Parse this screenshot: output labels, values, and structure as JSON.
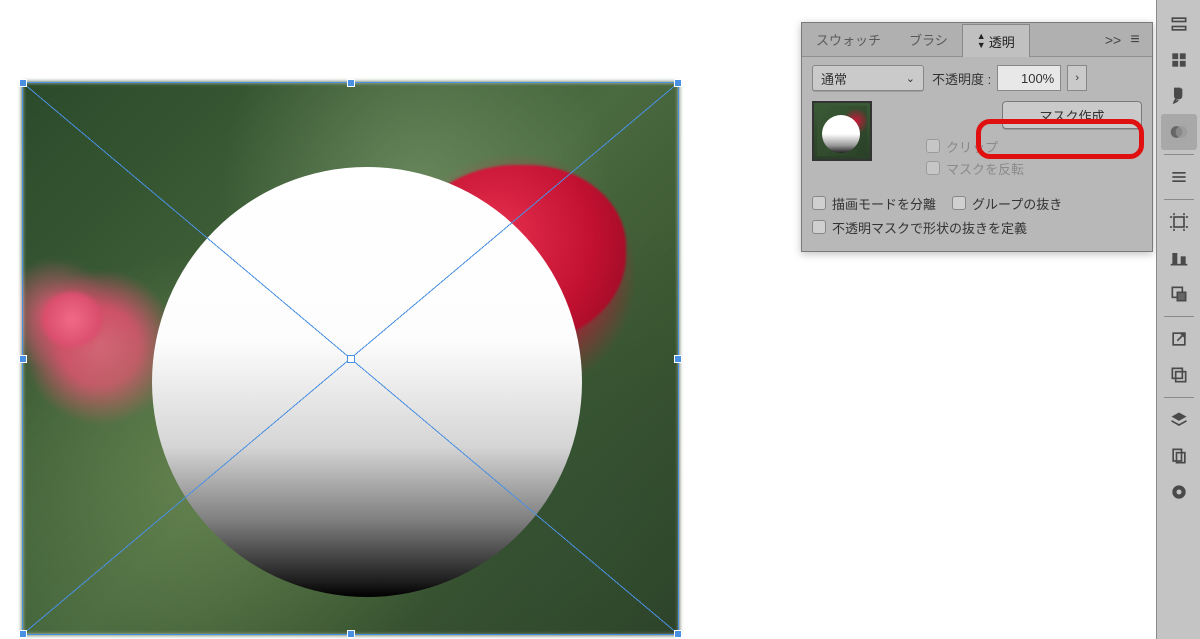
{
  "panel": {
    "tabs": {
      "swatches": "スウォッチ",
      "brushes": "ブラシ",
      "transparency": "透明"
    },
    "collapse": ">>",
    "blend_mode": "通常",
    "opacity_label": "不透明度 :",
    "opacity_value": "100%",
    "make_mask": "マスク作成",
    "clip": "クリップ",
    "invert_mask": "マスクを反転",
    "isolate_blending": "描画モードを分離",
    "knockout_group": "グループの抜き",
    "opacity_mask_define": "不透明マスクで形状の抜きを定義"
  },
  "dock": {
    "icons": [
      "properties-icon",
      "swatches-grid-icon",
      "brushes-icon",
      "transparency-icon",
      "lines-icon",
      "artboard-icon",
      "align-icon",
      "pathfinder-icon",
      "export-icon",
      "libraries-icon",
      "layers-icon",
      "appearance-icon",
      "color-icon"
    ]
  }
}
